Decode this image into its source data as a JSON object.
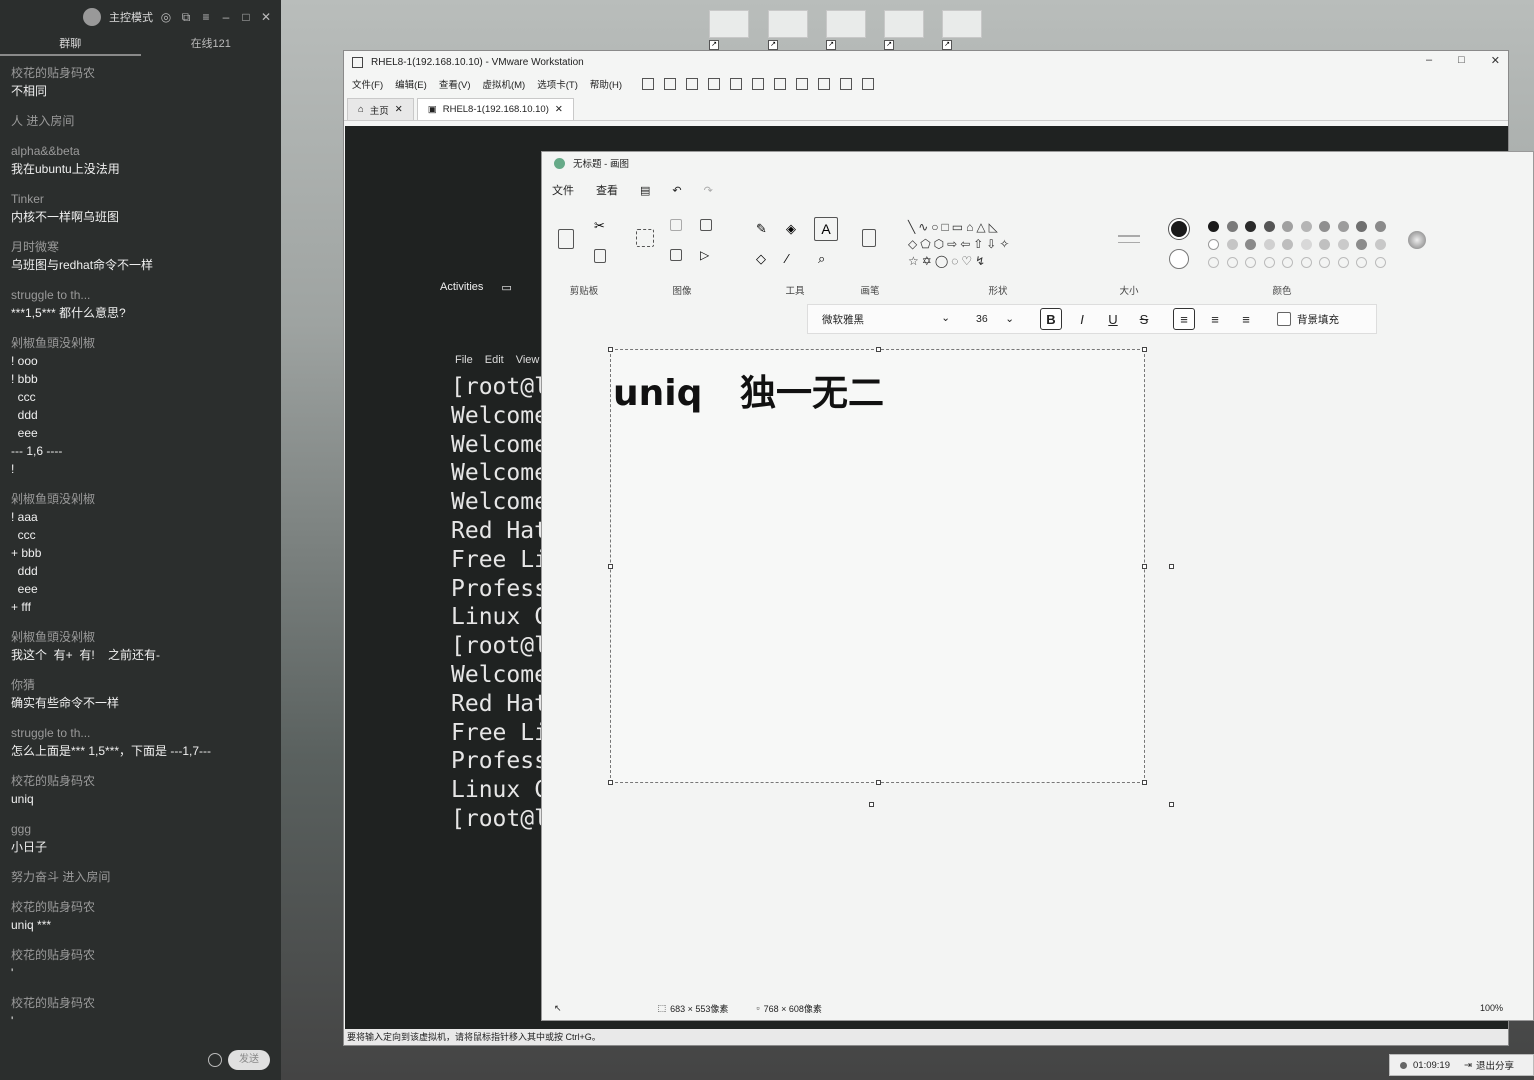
{
  "chat": {
    "mode_label": "主控模式",
    "tabs": [
      "群聊",
      "在线121"
    ],
    "send_label": "发送",
    "messages": [
      {
        "who": "校花的贴身码农",
        "text": "不相同"
      },
      {
        "sys": "人 进入房间"
      },
      {
        "who": "alpha&&beta",
        "text": "我在ubuntu上没法用"
      },
      {
        "who": "Tinker",
        "text": "内核不一样啊乌班图"
      },
      {
        "who": "月时微寒",
        "text": "乌班图与redhat命令不一样"
      },
      {
        "who": "struggle to th...",
        "text": "***1,5*** 都什么意思?"
      },
      {
        "who": "剁椒鱼頭没剁椒",
        "text": "! ooo\n! bbb\n  ccc\n  ddd\n  eee\n--- 1,6 ----\n!"
      },
      {
        "who": "剁椒鱼頭没剁椒",
        "text": "! aaa\n  ccc\n+ bbb\n  ddd\n  eee\n+ fff"
      },
      {
        "who": "剁椒鱼頭没剁椒",
        "text": "我这个  有+  有!    之前还有-"
      },
      {
        "who": "你猜",
        "text": "确实有些命令不一样"
      },
      {
        "who": "struggle to th...",
        "text": "怎么上面是*** 1,5***，下面是 ---1,7---"
      },
      {
        "who": "校花的贴身码农",
        "text": "uniq"
      },
      {
        "who": "ggg",
        "text": "小日子"
      },
      {
        "sys": "努力奋斗 进入房间"
      },
      {
        "who": "校花的贴身码农",
        "text": "uniq ***"
      },
      {
        "who": "校花的贴身码农",
        "text": "'"
      },
      {
        "who": "校花的贴身码农",
        "text": "'"
      }
    ]
  },
  "vmware": {
    "title": "RHEL8-1(192.168.10.10) - VMware Workstation",
    "menu": [
      "文件(F)",
      "编辑(E)",
      "查看(V)",
      "虚拟机(M)",
      "选项卡(T)",
      "帮助(H)"
    ],
    "tabs": [
      "主页",
      "RHEL8-1(192.168.10.10)"
    ],
    "status": "要将输入定向到该虚拟机，请将鼠标指针移入其中或按 Ctrl+G。",
    "guest": {
      "activities": "Activities",
      "term_menu": [
        "File",
        "Edit",
        "View"
      ],
      "term_lines": [
        "[root@l",
        "Welcome",
        "Welcome",
        "Welcome",
        "Welcome",
        "Red Hat",
        "Free Li",
        "Profess",
        "Linux C",
        "[root@l",
        "Welcome",
        "Red Hat",
        "Free Li",
        "Profess",
        "Linux C",
        "[root@l"
      ]
    }
  },
  "paint": {
    "title": "无标题 - 画图",
    "menu": [
      "文件",
      "查看"
    ],
    "groups": [
      "剪贴板",
      "图像",
      "工具",
      "画笔",
      "形状",
      "大小",
      "颜色"
    ],
    "font_name": "微软雅黑",
    "font_size": "36",
    "fill_label": "背景填充",
    "canvas_text": "uniq   独一无二",
    "selection_size": "683 × 553像素",
    "canvas_size": "768 × 608像素",
    "zoom": "100%"
  },
  "taskbar": {
    "time": "01:09:19",
    "exit_share": "退出分享"
  },
  "colors": {
    "palette_row1": [
      "#1a1a1a",
      "#7a7a7a",
      "#2a2a2a",
      "#555555",
      "#a0a0a0",
      "#b5b5b5",
      "#8f8f8f",
      "#9c9c9c",
      "#6f6f6f",
      "#8a8a8a"
    ],
    "palette_row2": [
      "#ffffff",
      "#c5c5c5",
      "#8a8a8a",
      "#d0d0d0",
      "#bdbdbd",
      "#d8d8d8",
      "#c0c0c0",
      "#cacaca",
      "#8c8c8c",
      "#c8c8c8"
    ]
  }
}
